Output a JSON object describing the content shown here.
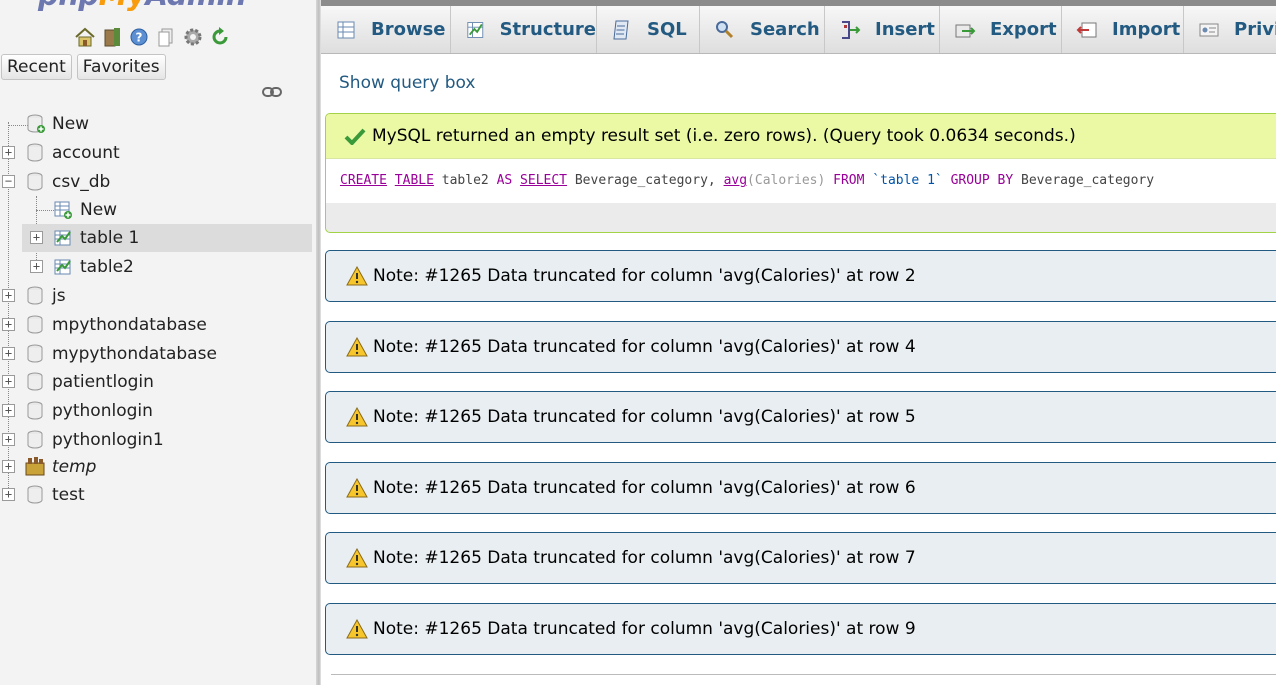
{
  "app": {
    "logo_php": "php",
    "logo_my": "My",
    "logo_admin": "Admin"
  },
  "nav": {
    "quick_icons": [
      "home-icon",
      "exit-icon",
      "help-icon",
      "docs-icon",
      "settings-icon",
      "reload-icon"
    ],
    "recent_label": "Recent",
    "favorites_label": "Favorites",
    "tree": {
      "new": "New",
      "databases": [
        "account",
        "csv_db",
        "js",
        "mpythondatabase",
        "mypythondatabase",
        "patientlogin",
        "pythonlogin",
        "pythonlogin1",
        "temp",
        "test"
      ],
      "csv_db_children": {
        "new": "New",
        "tables": [
          "table 1",
          "table2"
        ]
      }
    }
  },
  "menu": {
    "tabs": [
      "Browse",
      "Structure",
      "SQL",
      "Search",
      "Insert",
      "Export",
      "Import",
      "Privi"
    ]
  },
  "main": {
    "show_query_box": "Show query box",
    "success_message": "MySQL returned an empty result set (i.e. zero rows). (Query took 0.0634 seconds.)",
    "sql": {
      "create": "CREATE",
      "table": "TABLE",
      "name": "table2",
      "as": "AS",
      "select": "SELECT",
      "col": "Beverage_category,",
      "avg": "avg",
      "avg_arg": "(Calories)",
      "from": "FROM",
      "tbl": "`table 1`",
      "group_by": "GROUP BY",
      "group_col": "Beverage_category"
    },
    "notes": [
      "Note: #1265 Data truncated for column 'avg(Calories)' at row 2",
      "Note: #1265 Data truncated for column 'avg(Calories)' at row 4",
      "Note: #1265 Data truncated for column 'avg(Calories)' at row 5",
      "Note: #1265 Data truncated for column 'avg(Calories)' at row 6",
      "Note: #1265 Data truncated for column 'avg(Calories)' at row 7",
      "Note: #1265 Data truncated for column 'avg(Calories)' at row 9"
    ]
  },
  "colors": {
    "link": "#235a81",
    "success_bg": "#ebf8a4",
    "note_bg": "#e8eef1"
  }
}
